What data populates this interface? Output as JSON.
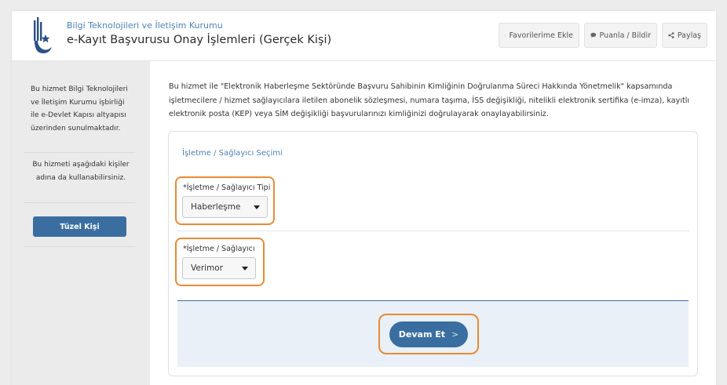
{
  "header": {
    "organization": "Bilgi Teknolojileri ve İletişim Kurumu",
    "title": "e-Kayıt Başvurusu Onay İşlemleri (Gerçek Kişi)",
    "buttons": {
      "favorite": "Favorilerime Ekle",
      "rate": "Puanla / Bildir",
      "share": "Paylaş"
    }
  },
  "sidebar": {
    "info_text": "Bu hizmet Bilgi Teknolojileri ve İletişim Kurumu işbirliği ile e-Devlet Kapısı altyapısı üzerinden sunulmaktadır.",
    "persons_text": "Bu hizmeti aşağıdaki kişiler adına da kullanabilirsiniz.",
    "legal_person_button": "Tüzel Kişi"
  },
  "main": {
    "intro": "Bu hizmet ile \"Elektronik Haberleşme Sektöründe Başvuru Sahibinin Kimliğinin Doğrulanma Süreci Hakkında Yönetmelik\" kapsamında işletmecilere / hizmet sağlayıcılara iletilen abonelik sözleşmesi, numara taşıma, İSS değişikliği, nitelikli elektronik sertifika (e-imza), kayıtlı elektronik posta (KEP) veya SİM değişikliği başvurularınızı kimliğinizi doğrulayarak onaylayabilirsiniz.",
    "section_title": "İşletme / Sağlayıcı Seçimi",
    "type_field": {
      "label": "*İşletme / Sağlayıcı Tipi",
      "value": "Haberleşme"
    },
    "provider_field": {
      "label": "*İşletme / Sağlayıcı",
      "value": "Verimor"
    },
    "submit_label": "Devam Et",
    "submit_chevron": ">"
  },
  "colors": {
    "accent": "#3a6ea0",
    "link": "#4f82b5",
    "highlight": "#e98a34"
  }
}
